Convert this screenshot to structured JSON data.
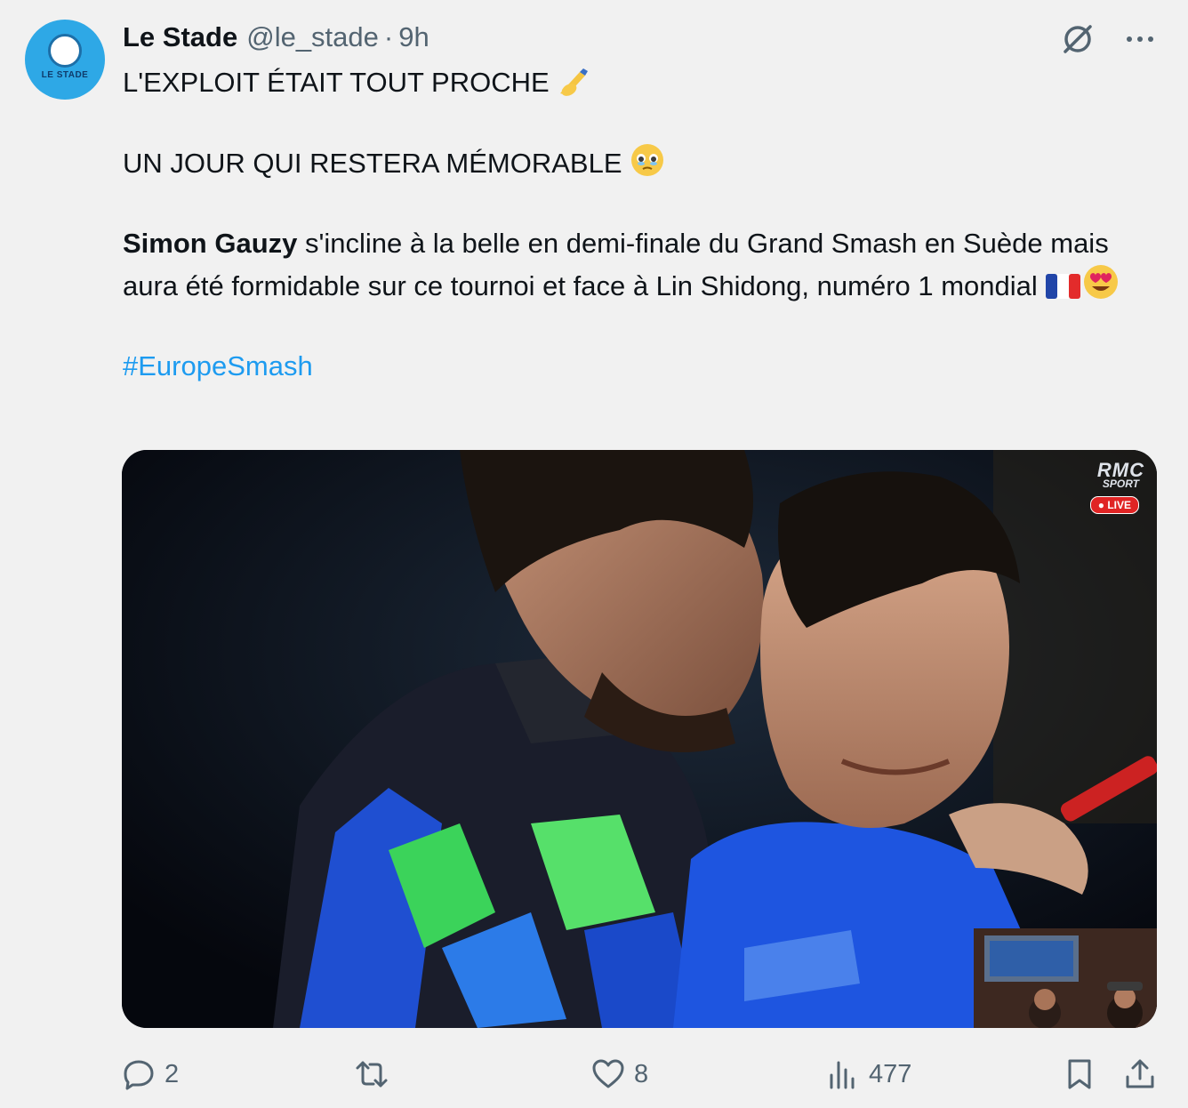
{
  "author": {
    "name": "Le Stade",
    "handle": "@le_stade",
    "separator": "·",
    "time": "9h",
    "avatar_text": "LE STADE"
  },
  "tweet": {
    "line1": "L'EXPLOIT ÉTAIT TOUT PROCHE",
    "line1_emoji": "writing-hand",
    "line2": "UN JOUR QUI RESTERA MÉMORABLE",
    "line2_emoji": "face-holding-back-tears",
    "bold_name": "Simon Gauzy",
    "body": " s'incline à la belle en demi-finale du Grand Smash en Suède mais aura été formidable sur ce tournoi et face à Lin Shidong, numéro 1 mondial",
    "body_emojis": [
      "flag-france",
      "heart-eyes"
    ],
    "hashtag": "#EuropeSmash"
  },
  "media": {
    "logo_main": "RMC",
    "logo_sub": "SPORT",
    "live_badge": "● LIVE"
  },
  "actions": {
    "replies": "2",
    "reposts": "",
    "likes": "8",
    "views": "477"
  },
  "colors": {
    "text": "#0f1419",
    "secondary": "#536471",
    "link": "#1d9bf0",
    "background": "#f1f1f1"
  }
}
